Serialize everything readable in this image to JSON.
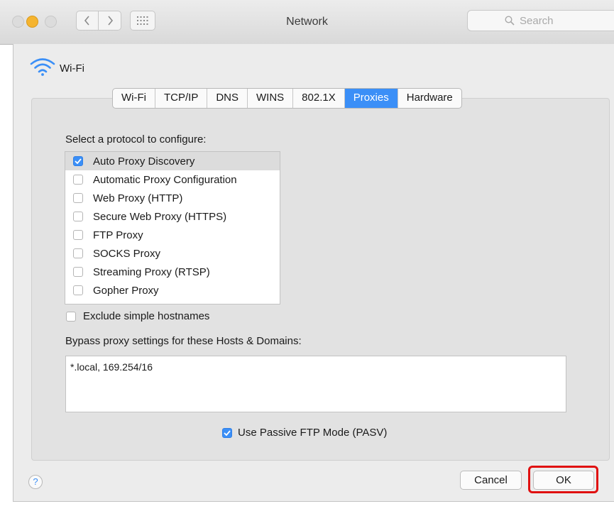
{
  "window": {
    "title": "Network"
  },
  "search": {
    "placeholder": "Search"
  },
  "interface": {
    "name": "Wi-Fi"
  },
  "tabs": [
    {
      "label": "Wi-Fi",
      "active": false
    },
    {
      "label": "TCP/IP",
      "active": false
    },
    {
      "label": "DNS",
      "active": false
    },
    {
      "label": "WINS",
      "active": false
    },
    {
      "label": "802.1X",
      "active": false
    },
    {
      "label": "Proxies",
      "active": true
    },
    {
      "label": "Hardware",
      "active": false
    }
  ],
  "proxies": {
    "select_label": "Select a protocol to configure:",
    "protocols": [
      {
        "label": "Auto Proxy Discovery",
        "checked": true,
        "selected": true
      },
      {
        "label": "Automatic Proxy Configuration",
        "checked": false,
        "selected": false
      },
      {
        "label": "Web Proxy (HTTP)",
        "checked": false,
        "selected": false
      },
      {
        "label": "Secure Web Proxy (HTTPS)",
        "checked": false,
        "selected": false
      },
      {
        "label": "FTP Proxy",
        "checked": false,
        "selected": false
      },
      {
        "label": "SOCKS Proxy",
        "checked": false,
        "selected": false
      },
      {
        "label": "Streaming Proxy (RTSP)",
        "checked": false,
        "selected": false
      },
      {
        "label": "Gopher Proxy",
        "checked": false,
        "selected": false
      }
    ],
    "exclude_simple": {
      "label": "Exclude simple hostnames",
      "checked": false
    },
    "bypass_label": "Bypass proxy settings for these Hosts & Domains:",
    "bypass_value": "*.local, 169.254/16",
    "pasv": {
      "label": "Use Passive FTP Mode (PASV)",
      "checked": true
    }
  },
  "footer": {
    "help": "?",
    "cancel": "Cancel",
    "ok": "OK"
  },
  "colors": {
    "accent": "#3b8ff7",
    "highlight": "#e01010"
  }
}
